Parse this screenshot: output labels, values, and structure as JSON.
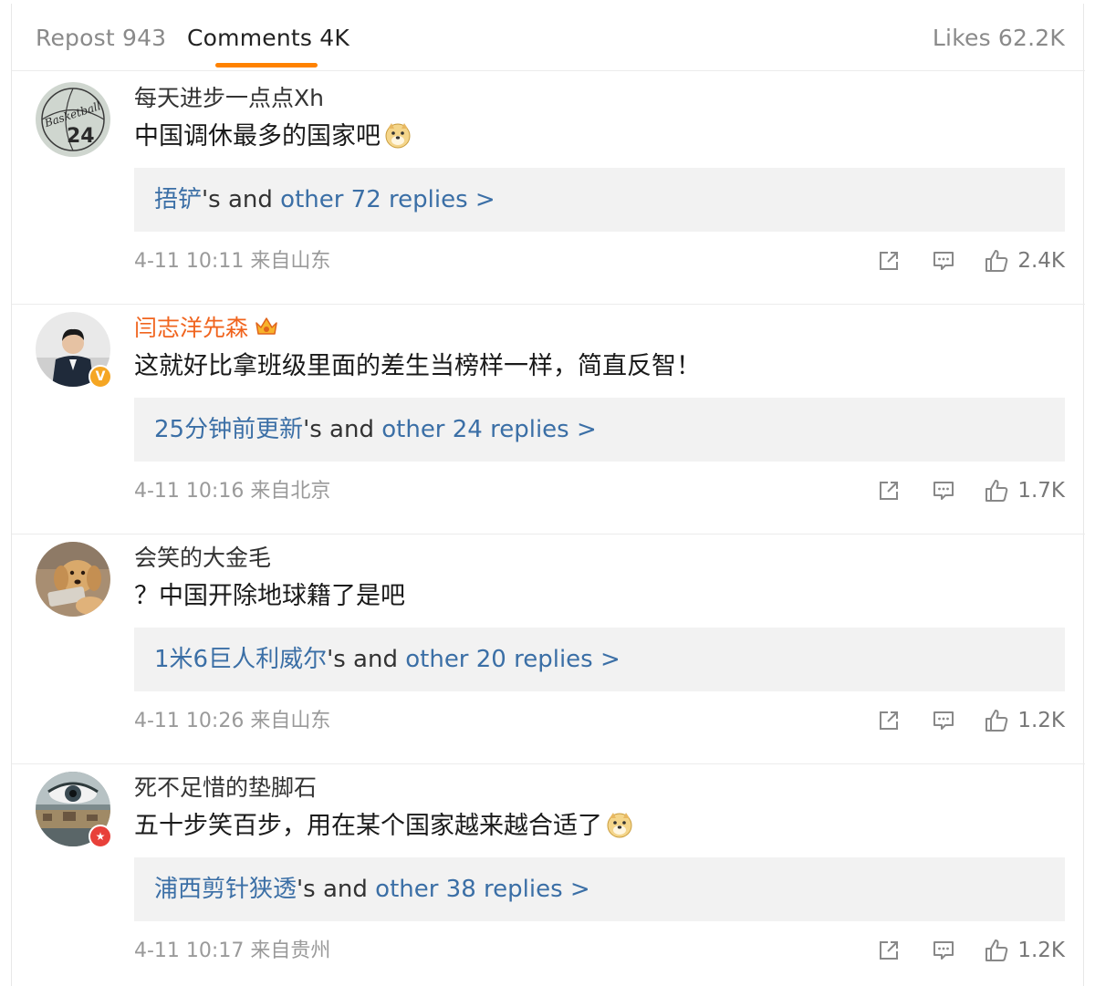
{
  "tabs": {
    "repost": "Repost 943",
    "comments": "Comments 4K",
    "likes": "Likes 62.2K"
  },
  "colors": {
    "accent": "#ff8200",
    "link": "#3b6fa6",
    "vip_name": "#f0641e"
  },
  "comments": [
    {
      "username": "每天进步一点点Xh",
      "text": "中国调休最多的国家吧",
      "emoji": "doge-emoji",
      "reply_user": "捂铲",
      "reply_joiner": "'s and ",
      "reply_more": "other 72 replies >",
      "time": "4-11 10:11",
      "location": "来自山东",
      "likes": "2.4K",
      "avatar_text": {
        "line1": "Basketball",
        "line2": "24"
      }
    },
    {
      "username": "闫志洋先森",
      "text": "这就好比拿班级里面的差生当榜样一样，简直反智！",
      "reply_user": "25分钟前更新",
      "reply_joiner": "'s and ",
      "reply_more": "other 24 replies >",
      "time": "4-11 10:16",
      "location": "来自北京",
      "likes": "1.7K",
      "badge": "V"
    },
    {
      "username": "会笑的大金毛",
      "text": "？中国开除地球籍了是吧",
      "reply_user": "1米6巨人利威尔",
      "reply_joiner": "'s and ",
      "reply_more": "other 20 replies >",
      "time": "4-11 10:26",
      "location": "来自山东",
      "likes": "1.2K"
    },
    {
      "username": "死不足惜的垫脚石",
      "text": "五十步笑百步，用在某个国家越来越合适了",
      "emoji": "doge-emoji",
      "reply_user": "浦西剪针狭透",
      "reply_joiner": "'s and ",
      "reply_more": "other 38 replies >",
      "time": "4-11 10:17",
      "location": "来自贵州",
      "likes": "1.2K",
      "badge": "★"
    }
  ]
}
